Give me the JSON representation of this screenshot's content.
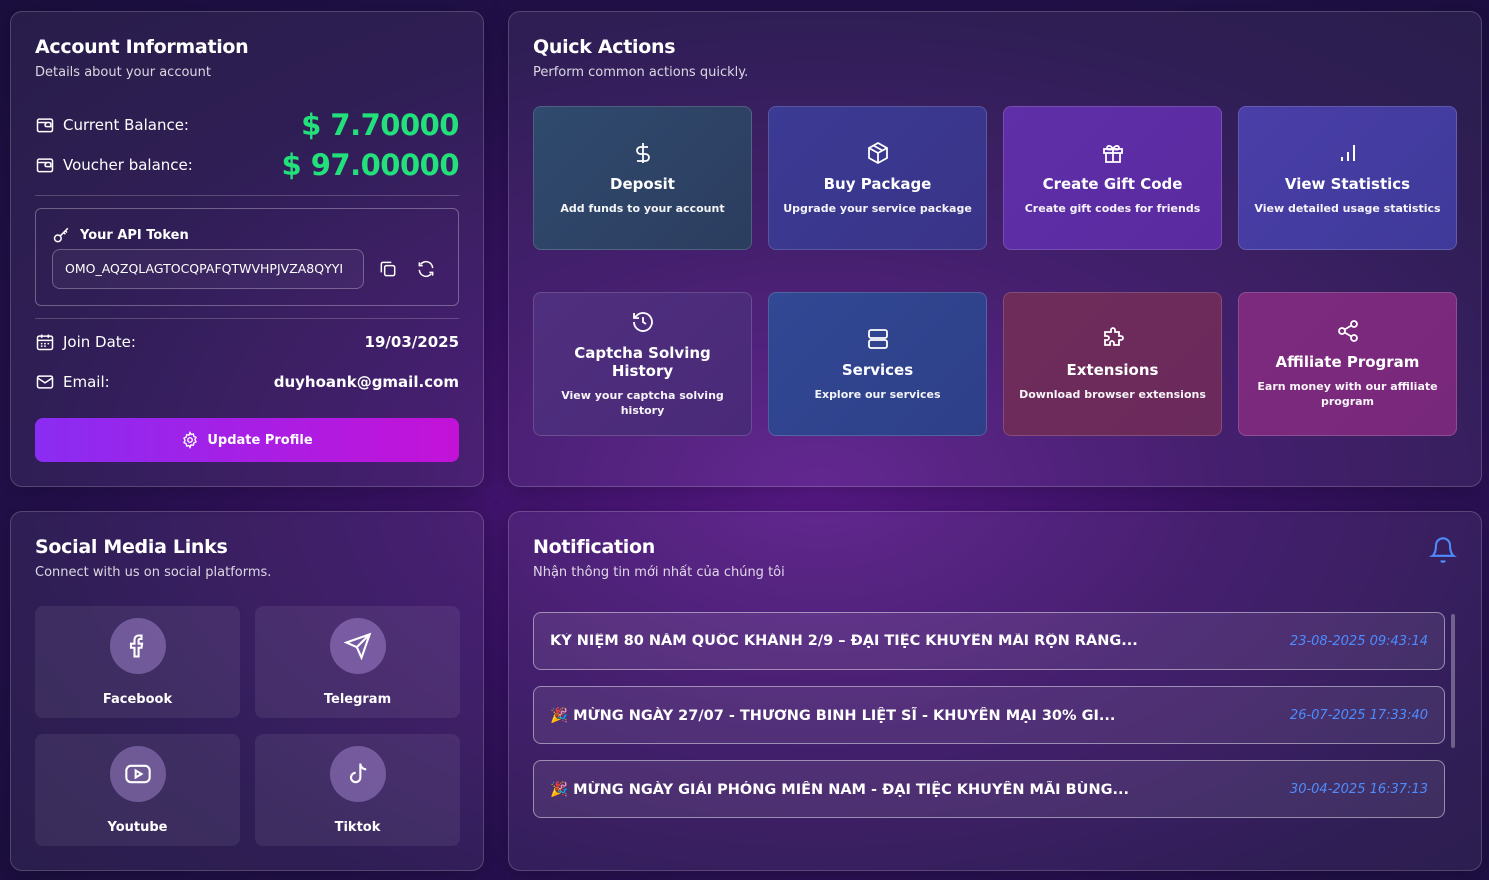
{
  "account": {
    "title": "Account Information",
    "subtitle": "Details about your account",
    "current_balance_label": "Current Balance:",
    "current_balance_value": "$ 7.70000",
    "voucher_balance_label": "Voucher balance:",
    "voucher_balance_value": "$ 97.00000",
    "api_token_label": "Your API Token",
    "api_token_value": "OMO_AQZQLAGTOCQPAFQTWVHPJVZA8QYYI",
    "join_date_label": "Join Date:",
    "join_date_value": "19/03/2025",
    "email_label": "Email:",
    "email_value": "duyhoank@gmail.com",
    "update_button": "Update Profile"
  },
  "quick_actions": {
    "title": "Quick Actions",
    "subtitle": "Perform common actions quickly.",
    "items": [
      {
        "title": "Deposit",
        "desc": "Add funds to your account",
        "icon": "dollar-icon"
      },
      {
        "title": "Buy Package",
        "desc": "Upgrade your service package",
        "icon": "package-icon"
      },
      {
        "title": "Create Gift Code",
        "desc": "Create gift codes for friends",
        "icon": "gift-icon"
      },
      {
        "title": "View Statistics",
        "desc": "View detailed usage statistics",
        "icon": "bar-chart-icon"
      },
      {
        "title": "Captcha Solving History",
        "desc": "View your captcha solving history",
        "icon": "history-icon"
      },
      {
        "title": "Services",
        "desc": "Explore our services",
        "icon": "server-icon"
      },
      {
        "title": "Extensions",
        "desc": "Download browser extensions",
        "icon": "puzzle-icon"
      },
      {
        "title": "Affiliate Program",
        "desc": "Earn money with our affiliate program",
        "icon": "share-icon"
      }
    ]
  },
  "social": {
    "title": "Social Media Links",
    "subtitle": "Connect with us on social platforms.",
    "items": [
      {
        "label": "Facebook",
        "icon": "facebook-icon"
      },
      {
        "label": "Telegram",
        "icon": "telegram-icon"
      },
      {
        "label": "Youtube",
        "icon": "youtube-icon"
      },
      {
        "label": "Tiktok",
        "icon": "tiktok-icon"
      }
    ]
  },
  "notification": {
    "title": "Notification",
    "subtitle": "Nhận thông tin mới nhất của chúng tôi",
    "items": [
      {
        "text": "KỶ NIỆM 80 NĂM QUỐC KHÁNH 2/9 – ĐẠI TIỆC KHUYẾN MÃI RỘN RÀNG...",
        "time": "23-08-2025 09:43:14"
      },
      {
        "text": "🎉 MỪNG NGÀY 27/07 - THƯƠNG BINH LIỆT SĨ - KHUYẾN MẠI 30% GI...",
        "time": "26-07-2025 17:33:40"
      },
      {
        "text": "🎉 MỪNG NGÀY GIẢI PHÓNG MIỀN NAM - ĐẠI TIỆC KHUYẾN MÃI BÙNG...",
        "time": "30-04-2025 16:37:13"
      }
    ]
  },
  "colors": {
    "balance_green": "#22e07a",
    "time_blue": "#4d8cff",
    "button_gradient_start": "#8a2cf2",
    "button_gradient_end": "#c412d8"
  }
}
